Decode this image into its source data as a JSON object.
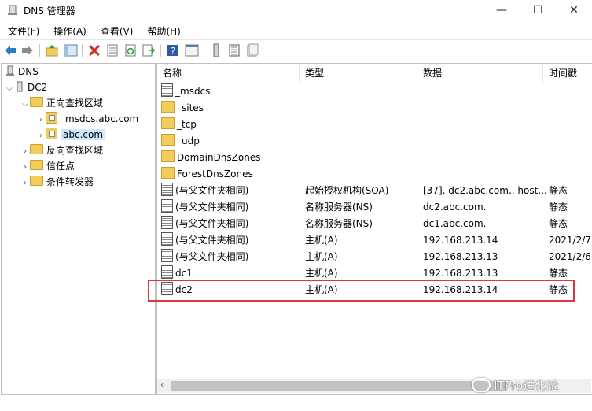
{
  "window": {
    "title": "DNS 管理器",
    "minimize": "—",
    "maximize": "☐",
    "close": "✕"
  },
  "menu": [
    "文件(F)",
    "操作(A)",
    "查看(V)",
    "帮助(H)"
  ],
  "tree": {
    "root": "DNS",
    "server": "DC2",
    "forward_zones": "正向查找区域",
    "msdcs_zone": "_msdcs.abc.com",
    "abc_zone": "abc.com",
    "reverse_zones": "反向查找区域",
    "trust_points": "信任点",
    "conditional_forwarders": "条件转发器"
  },
  "columns": [
    "名称",
    "类型",
    "数据",
    "时间戳"
  ],
  "rows": [
    {
      "name": "_msdcs",
      "type": "",
      "data": "",
      "ts": "",
      "icon": "zone"
    },
    {
      "name": "_sites",
      "type": "",
      "data": "",
      "ts": "",
      "icon": "folder"
    },
    {
      "name": "_tcp",
      "type": "",
      "data": "",
      "ts": "",
      "icon": "folder"
    },
    {
      "name": "_udp",
      "type": "",
      "data": "",
      "ts": "",
      "icon": "folder"
    },
    {
      "name": "DomainDnsZones",
      "type": "",
      "data": "",
      "ts": "",
      "icon": "folder"
    },
    {
      "name": "ForestDnsZones",
      "type": "",
      "data": "",
      "ts": "",
      "icon": "folder"
    },
    {
      "name": "(与父文件夹相同)",
      "type": "起始授权机构(SOA)",
      "data": "[37], dc2.abc.com., host...",
      "ts": "静态",
      "icon": "record"
    },
    {
      "name": "(与父文件夹相同)",
      "type": "名称服务器(NS)",
      "data": "dc2.abc.com.",
      "ts": "静态",
      "icon": "record"
    },
    {
      "name": "(与父文件夹相同)",
      "type": "名称服务器(NS)",
      "data": "dc1.abc.com.",
      "ts": "静态",
      "icon": "record"
    },
    {
      "name": "(与父文件夹相同)",
      "type": "主机(A)",
      "data": "192.168.213.14",
      "ts": "2021/2/7",
      "icon": "record"
    },
    {
      "name": "(与父文件夹相同)",
      "type": "主机(A)",
      "data": "192.168.213.13",
      "ts": "2021/2/6",
      "icon": "record"
    },
    {
      "name": "dc1",
      "type": "主机(A)",
      "data": "192.168.213.13",
      "ts": "静态",
      "icon": "record"
    },
    {
      "name": "dc2",
      "type": "主机(A)",
      "data": "192.168.213.14",
      "ts": "静态",
      "icon": "record"
    }
  ],
  "watermark": "ITPro进化论"
}
